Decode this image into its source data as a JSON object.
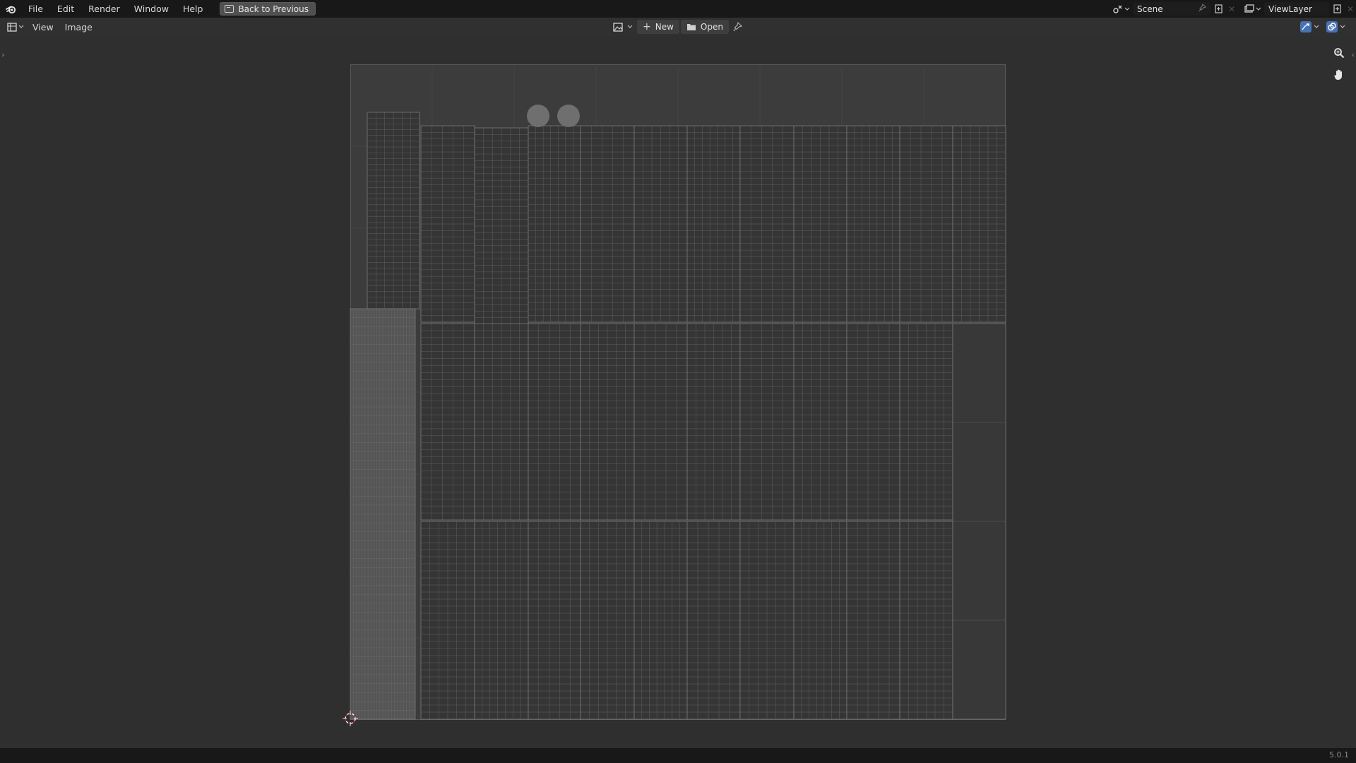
{
  "topbar": {
    "menu": [
      "File",
      "Edit",
      "Render",
      "Window",
      "Help"
    ],
    "back_label": "Back to Previous",
    "scene_name": "Scene",
    "view_layer": "ViewLayer"
  },
  "editor_header": {
    "menus": [
      "View",
      "Image"
    ],
    "new_label": "New",
    "open_label": "Open"
  },
  "status": {
    "version": "5.0.1"
  },
  "colors": {
    "accent": "#4772b3",
    "topbar_bg": "#181818",
    "viewport_bg": "#2f2f2f",
    "uv_wire": "#6e6e6e"
  },
  "icons": [
    "blender-logo-icon",
    "back-icon",
    "scene-icon",
    "pin-icon",
    "new-scene-icon",
    "close-icon",
    "view-layer-icon",
    "editor-type-icon",
    "image-browse-icon",
    "plus-icon",
    "folder-icon",
    "pin-icon",
    "gizmo-icon",
    "overlay-icon",
    "zoom-icon",
    "hand-icon",
    "cursor-3d-icon"
  ]
}
